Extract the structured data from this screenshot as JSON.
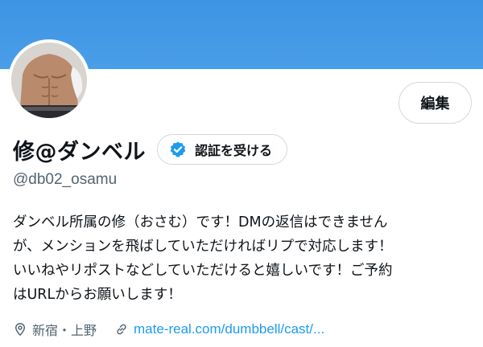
{
  "profile": {
    "banner_color": "#4a9ee8",
    "avatar_description_icon": "avatar-photo",
    "edit_label": "編集",
    "display_name": "修@ダンベル",
    "verify_label": "認証を受ける",
    "handle": "@db02_osamu",
    "bio_lines": [
      "ダンベル所属の修（おさむ）です！DMの返信はできません",
      "が、メンションを飛ばしていただければリプで対応します！",
      "いいねやリポストなどしていただけると嬉しいです！ご予約",
      "はURLからお願いします！"
    ],
    "location": "新宿・上野",
    "link": "mate-real.com/dumbbell/cast/..."
  },
  "colors": {
    "accent": "#1d9bf0",
    "muted": "#536471",
    "text": "#0f1419",
    "border": "#cfd9de"
  }
}
